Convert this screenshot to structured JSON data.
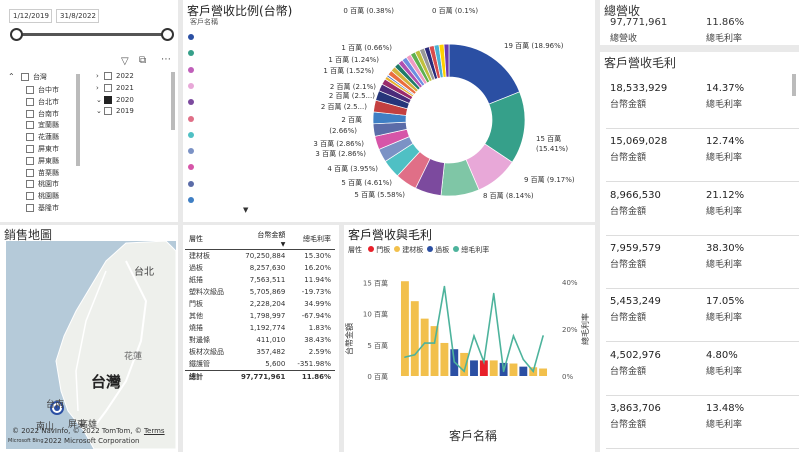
{
  "date_slicer": {
    "start": "1/12/2019",
    "end": "31/8/2022"
  },
  "region_slicer": {
    "root": "台灣",
    "items": [
      "台中市",
      "台北市",
      "台南市",
      "宜蘭縣",
      "花蓮縣",
      "屏東市",
      "屏東縣",
      "苗栗縣",
      "桃園市",
      "桃園縣",
      "基隆市"
    ]
  },
  "year_slicer": {
    "items": [
      {
        "label": "2022",
        "checked": false,
        "expanded": false
      },
      {
        "label": "2021",
        "checked": false,
        "expanded": false
      },
      {
        "label": "2020",
        "checked": true,
        "expanded": true
      },
      {
        "label": "2019",
        "checked": false,
        "expanded": true
      }
    ]
  },
  "pie": {
    "title": "客戶營收比例(台幣)",
    "legend_title": "客戶名稱",
    "legend_colors": [
      "#2b4fa3",
      "#36a08a",
      "#c05fba",
      "#e8a8d8",
      "#7c4a9e",
      "#e06f87",
      "#4fc0c4",
      "#7b92c5",
      "#d655a8",
      "#5b6ca8",
      "#3f7fc4"
    ],
    "labels": [
      "0 百萬 (0.38%)",
      "0 百萬 (0.1%)",
      "1 百萬 (0.66%)",
      "1 百萬 (1.24%)",
      "1 百萬 (1.52%)",
      "2 百萬 (2.1%)",
      "2 百萬 (2.5...)",
      "2 百萬 (2.5...)",
      "2 百萬",
      "(2.66%)",
      "3 百萬 (2.86%)",
      "3 百萬 (2.86%)",
      "4 百萬 (3.95%)",
      "5 百萬 (4.61%)",
      "5 百萬 (5.58%)",
      "19 百萬 (18.96%)",
      "15 百萬",
      "(15.41%)",
      "9 百萬 (9.17%)",
      "8 百萬 (8.14%)"
    ]
  },
  "kpi_total": {
    "value": "97,771,961",
    "value_label": "總營收",
    "margin": "11.86%",
    "margin_label": "總毛利率",
    "title": "總營收"
  },
  "customer_cards": {
    "title": "客戶營收毛利",
    "amount_label": "台幣金額",
    "margin_label": "總毛利率",
    "items": [
      {
        "amount": "18,533,929",
        "margin": "14.37%"
      },
      {
        "amount": "15,069,028",
        "margin": "12.74%"
      },
      {
        "amount": "8,966,530",
        "margin": "21.12%"
      },
      {
        "amount": "7,959,579",
        "margin": "38.30%"
      },
      {
        "amount": "5,453,249",
        "margin": "17.05%"
      },
      {
        "amount": "4,502,976",
        "margin": "4.80%"
      },
      {
        "amount": "3,863,706",
        "margin": "13.48%"
      }
    ]
  },
  "map": {
    "title": "銷售地圖",
    "labels": [
      "台北",
      "台灣",
      "花蓮",
      "台南",
      "屏東",
      "南山",
      "高雄"
    ],
    "credit1": "© 2022 NavInfo, © 2022 TomTom, ©",
    "credit_terms": "Terms",
    "credit2": "2022 Microsoft Corporation",
    "ms_brand": "Microsoft Bing"
  },
  "table": {
    "headers": [
      "層性",
      "台幣金額",
      "總毛利率"
    ],
    "rows": [
      [
        "建材板",
        "70,250,884",
        "15.30%"
      ],
      [
        "過板",
        "8,257,630",
        "16.20%"
      ],
      [
        "紙捲",
        "7,563,511",
        "11.94%"
      ],
      [
        "塑料次級品",
        "5,705,869",
        "-19.73%"
      ],
      [
        "門板",
        "2,228,204",
        "34.99%"
      ],
      [
        "其他",
        "1,798,997",
        "-67.94%"
      ],
      [
        "燒捲",
        "1,192,774",
        "1.83%"
      ],
      [
        "對邊條",
        "411,010",
        "38.43%"
      ],
      [
        "板材次級品",
        "357,482",
        "2.59%"
      ],
      [
        "鐵護管",
        "5,600",
        "-351.98%"
      ]
    ],
    "total": [
      "總計",
      "97,771,961",
      "11.86%"
    ]
  },
  "combo": {
    "title": "客戶營收與毛利",
    "legend_title": "層性",
    "legend": [
      {
        "name": "門板",
        "color": "#e8202a"
      },
      {
        "name": "建材板",
        "color": "#f2c04c"
      },
      {
        "name": "過板",
        "color": "#2b4fa3"
      },
      {
        "name": "總毛利率",
        "color": "#4db39c"
      }
    ],
    "y_axis_label": "台幣金額",
    "y2_axis_label": "總毛利率",
    "x_axis_label": "客戶名稱",
    "y_ticks": [
      "15 百萬",
      "10 百萬",
      "5 百萬",
      "0 百萬"
    ],
    "y2_ticks": [
      "40%",
      "20%",
      "0%"
    ]
  },
  "chart_data": {
    "type": "bar",
    "title": "客戶營收與毛利",
    "xlabel": "客戶名稱",
    "ylabel": "台幣金額",
    "y2label": "總毛利率",
    "ylim": [
      0,
      17
    ],
    "y2lim": [
      0,
      45
    ],
    "bar_values": [
      15.2,
      12.0,
      9.2,
      8.0,
      5.3,
      4.3,
      3.7,
      2.5,
      2.5,
      2.5,
      2.1,
      2.0,
      1.5,
      1.4,
      1.2
    ],
    "bar_colors": [
      "#f2c04c",
      "#f2c04c",
      "#f2c04c",
      "#f2c04c",
      "#f2c04c",
      "#2b4fa3",
      "#f2c04c",
      "#2b4fa3",
      "#e8202a",
      "#f2c04c",
      "#2b4fa3",
      "#f2c04c",
      "#2b4fa3",
      "#f2c04c",
      "#f2c04c"
    ],
    "line_values": [
      8,
      9,
      14,
      14,
      38,
      6,
      2,
      17,
      6,
      35,
      2,
      17,
      7,
      2,
      17
    ],
    "line_color": "#4db39c"
  }
}
